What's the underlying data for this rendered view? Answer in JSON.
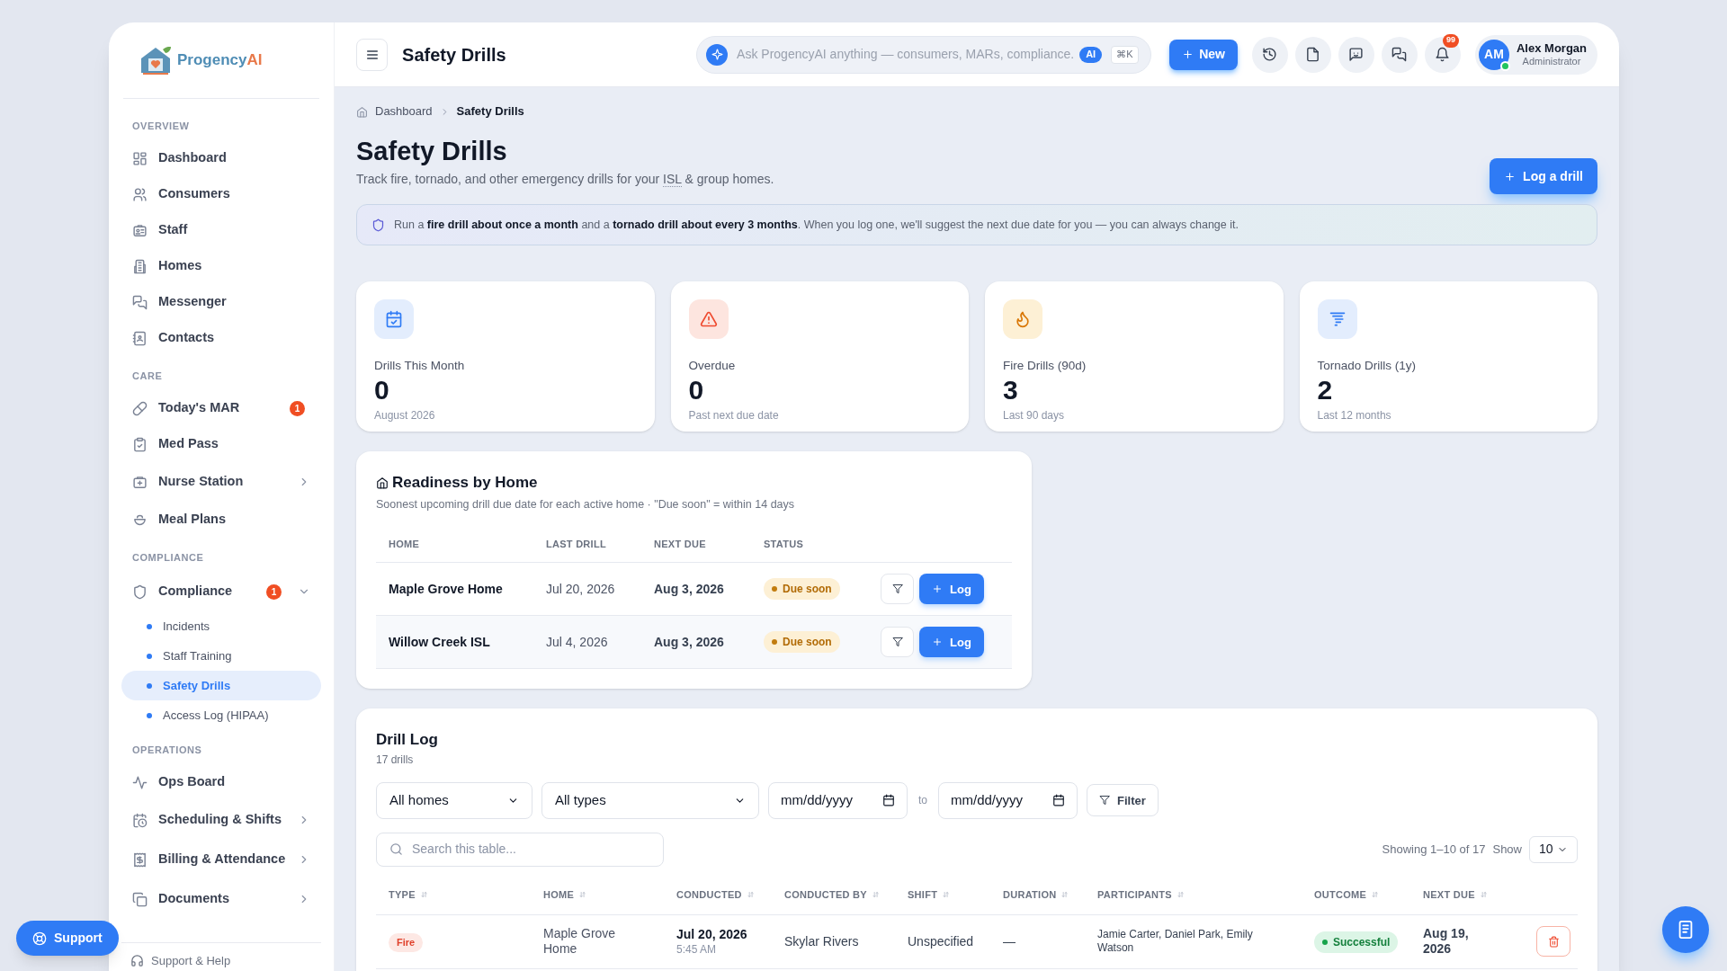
{
  "logo": {
    "text": "Progency",
    "accent": "AI"
  },
  "sidebar": {
    "sections": [
      {
        "label": "OVERVIEW",
        "items": [
          {
            "label": "Dashboard",
            "selected": false
          },
          {
            "label": "Consumers",
            "selected": false
          },
          {
            "label": "Staff",
            "selected": false
          },
          {
            "label": "Homes",
            "selected": false
          },
          {
            "label": "Messenger",
            "selected": false
          },
          {
            "label": "Contacts",
            "selected": false
          }
        ]
      },
      {
        "label": "CARE",
        "items": [
          {
            "label": "Today's MAR",
            "selected": false,
            "badge": "1"
          },
          {
            "label": "Med Pass",
            "selected": false
          },
          {
            "label": "Nurse Station",
            "selected": false,
            "expanded": false
          },
          {
            "label": "Meal Plans",
            "selected": false
          }
        ]
      },
      {
        "label": "COMPLIANCE",
        "items": [
          {
            "label": "Compliance",
            "selected": false,
            "badge": "1",
            "expanded": true,
            "children": [
              {
                "label": "Incidents",
                "selected": false
              },
              {
                "label": "Staff Training",
                "selected": false
              },
              {
                "label": "Safety Drills",
                "selected": true
              },
              {
                "label": "Access Log (HIPAA)",
                "selected": false
              }
            ]
          }
        ]
      },
      {
        "label": "OPERATIONS",
        "items": [
          {
            "label": "Ops Board",
            "selected": false
          },
          {
            "label": "Scheduling & Shifts",
            "selected": false,
            "expanded": false
          },
          {
            "label": "Billing & Attendance",
            "selected": false,
            "expanded": false
          },
          {
            "label": "Documents",
            "selected": false,
            "expanded": false
          }
        ]
      }
    ],
    "footer": "Support & Help"
  },
  "header": {
    "title": "Safety Drills",
    "search": {
      "placeholder": "Ask ProgencyAI anything — consumers, MARs, compliance.",
      "ai_badge": "AI",
      "shortcut": "⌘K"
    },
    "new_button": "New",
    "notification_count": "99",
    "user": {
      "initials": "AM",
      "name": "Alex Morgan",
      "role": "Administrator",
      "online": true
    }
  },
  "breadcrumb": [
    "Dashboard",
    "Safety Drills"
  ],
  "page": {
    "title": "Safety Drills",
    "subtitle_before": "Track fire, tornado, and other emergency drills for your ",
    "subtitle_abbr": "ISL",
    "subtitle_after": " & group homes.",
    "log_button": "Log a drill"
  },
  "banner": "Run a **fire drill about once a month** and a **tornado drill about every 3 months**. When you log one, we'll suggest the next due date for you — you can always change it.",
  "stats": [
    {
      "kind": "calendar",
      "label": "Drills This Month",
      "value": "0",
      "note": "August 2026"
    },
    {
      "kind": "warning",
      "label": "Overdue",
      "value": "0",
      "note": "Past next due date"
    },
    {
      "kind": "fire",
      "label": "Fire Drills (90d)",
      "value": "3",
      "note": "Last 90 days"
    },
    {
      "kind": "tornado",
      "label": "Tornado Drills (1y)",
      "value": "2",
      "note": "Last 12 months"
    }
  ],
  "readiness": {
    "title": "Readiness by Home",
    "subtitle": "Soonest upcoming drill due date for each active home · \"Due soon\" = within 14 days",
    "columns": [
      "HOME",
      "LAST DRILL",
      "NEXT DUE",
      "STATUS"
    ],
    "rows": [
      {
        "home": "Maple Grove Home",
        "last_drill": "Jul 20, 2026",
        "next_due": "Aug 3, 2026",
        "status": {
          "label": "Due soon",
          "kind": "due_soon"
        },
        "log_button": "Log"
      },
      {
        "home": "Willow Creek ISL",
        "last_drill": "Jul 4, 2026",
        "next_due": "Aug 3, 2026",
        "status": {
          "label": "Due soon",
          "kind": "due_soon"
        },
        "log_button": "Log"
      }
    ]
  },
  "drill_log": {
    "title": "Drill Log",
    "count": "17 drills",
    "home_filter": "All homes",
    "type_filter": "All types",
    "date_from": "mm/dd/yyyy",
    "to_label": "to",
    "date_to": "mm/dd/yyyy",
    "filter_button": "Filter",
    "search_placeholder": "Search this table...",
    "showing": "Showing 1–10 of 17",
    "show_label": "Show",
    "page_size": "10",
    "columns": [
      "TYPE",
      "HOME",
      "CONDUCTED",
      "CONDUCTED BY",
      "SHIFT",
      "DURATION",
      "PARTICIPANTS",
      "OUTCOME",
      "NEXT DUE"
    ],
    "rows": [
      {
        "type": {
          "label": "Fire",
          "kind": "fire"
        },
        "home": "Maple Grove Home",
        "conducted_date": "Jul 20, 2026",
        "conducted_time": "5:45 AM",
        "conducted_by": "Skylar Rivers",
        "shift": "Unspecified",
        "duration": "—",
        "participants": "Jamie Carter, Daniel Park, Emily Watson",
        "outcome": {
          "label": "Successful",
          "kind": "success"
        },
        "next_due": "Aug 19, 2026"
      }
    ]
  },
  "support_button": "Support"
}
